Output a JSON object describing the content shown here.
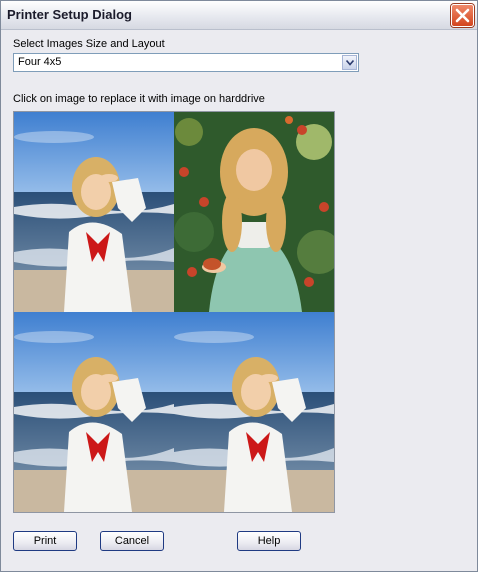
{
  "window": {
    "title": "Printer Setup Dialog"
  },
  "layout_select": {
    "label": "Select Images Size and Layout",
    "value": "Four 4x5"
  },
  "instructions": "Click on image to replace it with image on harddrive",
  "images": [
    {
      "subject": "girl-saluting-on-beach"
    },
    {
      "subject": "girl-holding-butterfly-in-garden"
    },
    {
      "subject": "girl-saluting-on-beach"
    },
    {
      "subject": "girl-saluting-on-beach"
    }
  ],
  "buttons": {
    "print": "Print",
    "cancel": "Cancel",
    "help": "Help"
  },
  "colors": {
    "title_bar": "#e7e9ef",
    "close_button": "#d2451e",
    "button_border": "#1f3a82"
  }
}
